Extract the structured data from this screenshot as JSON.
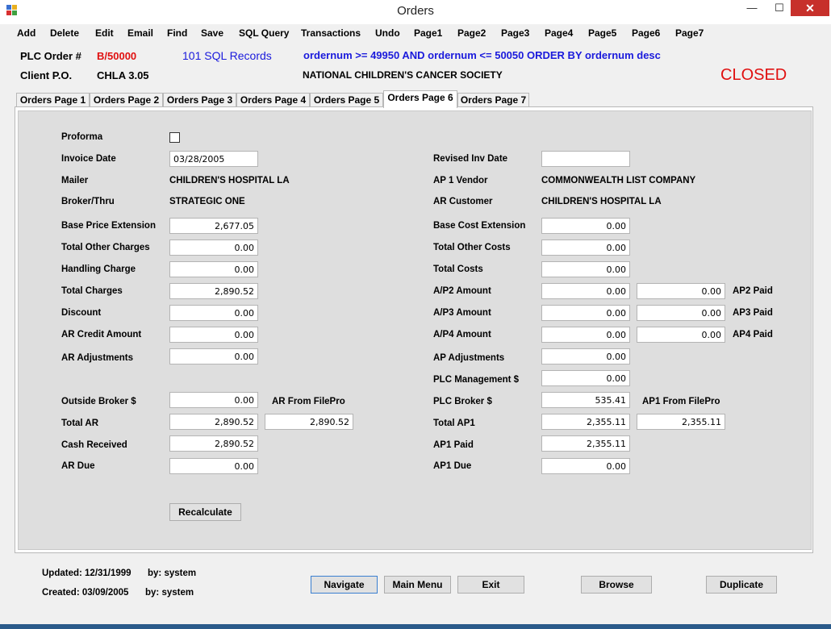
{
  "window": {
    "title": "Orders",
    "minimize": "—",
    "maximize": "☐",
    "close": "✕"
  },
  "menu": [
    "Add",
    "Delete",
    "Edit",
    "Email",
    "Find",
    "Save",
    "SQL Query",
    "Transactions",
    "Undo",
    "Page1",
    "Page2",
    "Page3",
    "Page4",
    "Page5",
    "Page6",
    "Page7"
  ],
  "header": {
    "plc_order_label": "PLC Order #",
    "plc_order_value": "B/50000",
    "records": "101 SQL Records",
    "query": "ordernum >= 49950 AND ordernum <= 50050 ORDER BY ordernum desc",
    "client_po_label": "Client P.O.",
    "client_po_value": "CHLA 3.05",
    "client_name": "NATIONAL CHILDREN'S CANCER SOCIETY",
    "status": "CLOSED",
    "status_color": "#e01010",
    "plc_order_color": "#e01010",
    "records_color": "#1a1adc"
  },
  "tabs": [
    "Orders Page 1",
    "Orders Page 2",
    "Orders Page 3",
    "Orders Page 4",
    "Orders Page 5",
    "Orders Page 6",
    "Orders Page 7"
  ],
  "active_tab": "Orders Page 6",
  "left": {
    "proforma_label": "Proforma",
    "proforma_checked": false,
    "invoice_date_label": "Invoice Date",
    "invoice_date": "03/28/2005",
    "mailer_label": "Mailer",
    "mailer": "CHILDREN'S HOSPITAL LA",
    "broker_label": "Broker/Thru",
    "broker": "STRATEGIC ONE",
    "base_price_label": "Base Price Extension",
    "base_price": "2,677.05",
    "total_other_charges_label": "Total Other Charges",
    "total_other_charges": "0.00",
    "handling_label": "Handling Charge",
    "handling": "0.00",
    "total_charges_label": "Total Charges",
    "total_charges": "2,890.52",
    "discount_label": "Discount",
    "discount": "0.00",
    "ar_credit_label": "AR Credit Amount",
    "ar_credit": "0.00",
    "ar_adjust_label": "AR Adjustments",
    "ar_adjust": "0.00",
    "outside_broker_label": "Outside Broker $",
    "outside_broker": "0.00",
    "ar_filepro_label": "AR From FilePro",
    "total_ar_label": "Total AR",
    "total_ar": "2,890.52",
    "ar_filepro": "2,890.52",
    "cash_received_label": "Cash Received",
    "cash_received": "2,890.52",
    "ar_due_label": "AR Due",
    "ar_due": "0.00",
    "recalculate": "Recalculate"
  },
  "right": {
    "revised_inv_label": "Revised Inv Date",
    "revised_inv": "",
    "ap1_vendor_label": "AP 1 Vendor",
    "ap1_vendor": "COMMONWEALTH LIST COMPANY",
    "ar_customer_label": "AR Customer",
    "ar_customer": "CHILDREN'S HOSPITAL LA",
    "base_cost_label": "Base Cost Extension",
    "base_cost": "0.00",
    "total_other_costs_label": "Total Other Costs",
    "total_other_costs": "0.00",
    "total_costs_label": "Total Costs",
    "total_costs": "0.00",
    "ap2_amount_label": "A/P2 Amount",
    "ap2_amount": "0.00",
    "ap2_paid_value": "0.00",
    "ap2_paid_label": "AP2 Paid",
    "ap3_amount_label": "A/P3 Amount",
    "ap3_amount": "0.00",
    "ap3_paid_value": "0.00",
    "ap3_paid_label": "AP3 Paid",
    "ap4_amount_label": "A/P4 Amount",
    "ap4_amount": "0.00",
    "ap4_paid_value": "0.00",
    "ap4_paid_label": "AP4 Paid",
    "ap_adjust_label": "AP Adjustments",
    "ap_adjust": "0.00",
    "plc_mgmt_label": "PLC Management $",
    "plc_mgmt": "0.00",
    "plc_broker_label": "PLC Broker $",
    "plc_broker": "535.41",
    "ap1_filepro_label": "AP1 From FilePro",
    "total_ap1_label": "Total AP1",
    "total_ap1": "2,355.11",
    "ap1_filepro": "2,355.11",
    "ap1_paid_label": "AP1 Paid",
    "ap1_paid": "2,355.11",
    "ap1_due_label": "AP1 Due",
    "ap1_due": "0.00"
  },
  "footer": {
    "updated": "Updated: 12/31/1999",
    "updated_by": "by: system",
    "created": "Created: 03/09/2005",
    "created_by": "by: system",
    "navigate": "Navigate",
    "main_menu": "Main Menu",
    "exit": "Exit",
    "browse": "Browse",
    "duplicate": "Duplicate"
  }
}
